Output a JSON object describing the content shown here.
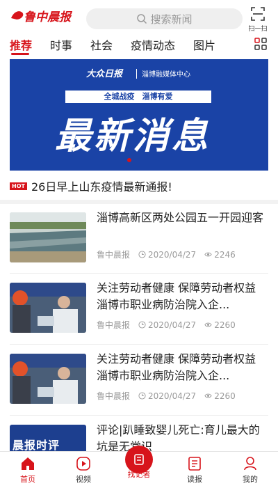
{
  "header": {
    "logo_text": "鲁中晨报",
    "search_placeholder": "搜索新闻",
    "scan_label": "扫一扫"
  },
  "tabs": [
    {
      "label": "推荐",
      "active": true
    },
    {
      "label": "时事"
    },
    {
      "label": "社会"
    },
    {
      "label": "疫情动态"
    },
    {
      "label": "图片"
    }
  ],
  "banner": {
    "brand": "大众日报",
    "brand_sub": "淄博融媒体中心",
    "slogan": "全城战疫　淄博有爱",
    "headline": "最新消息"
  },
  "hot": {
    "badge": "HOT",
    "text": "26日早上山东疫情最新通报!"
  },
  "news": [
    {
      "title": "淄博高新区两处公园五一开园迎客",
      "source": "鲁中晨报",
      "date": "2020/04/27",
      "views": "2246"
    },
    {
      "title": "关注劳动者健康 保障劳动者权益 淄博市职业病防治院入企...",
      "source": "鲁中晨报",
      "date": "2020/04/27",
      "views": "2260"
    },
    {
      "title": "关注劳动者健康 保障劳动者权益 淄博市职业病防治院入企...",
      "source": "鲁中晨报",
      "date": "2020/04/27",
      "views": "2260"
    },
    {
      "title": "评论|趴睡致婴儿死亡:育儿最大的坑是无常识",
      "thumb_text": "晨报时评"
    }
  ],
  "bottom_nav": [
    {
      "label": "首页",
      "icon": "home-icon",
      "active": true
    },
    {
      "label": "视频",
      "icon": "video-icon"
    },
    {
      "label": "找记者",
      "icon": "reporter-icon"
    },
    {
      "label": "读报",
      "icon": "newspaper-icon"
    },
    {
      "label": "我的",
      "icon": "user-icon"
    }
  ],
  "colors": {
    "accent": "#d7141b",
    "banner_bg": "#1a43a6"
  }
}
